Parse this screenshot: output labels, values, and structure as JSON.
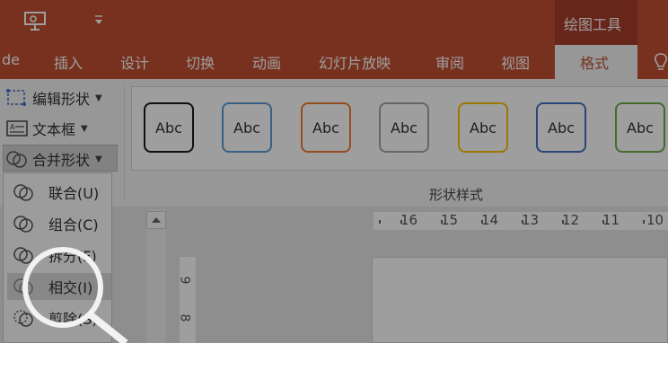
{
  "title_bar": {
    "drawing_tools_label": "绘图工具"
  },
  "tabs": [
    {
      "label": "de"
    },
    {
      "label": "插入"
    },
    {
      "label": "设计"
    },
    {
      "label": "切换"
    },
    {
      "label": "动画"
    },
    {
      "label": "幻灯片放映"
    },
    {
      "label": "审阅"
    },
    {
      "label": "视图"
    },
    {
      "label": "格式",
      "active": true
    }
  ],
  "ribbon": {
    "edit_shape": "编辑形状",
    "text_box": "文本框",
    "merge_shapes": "合并形状",
    "shape_styles_group": "形状样式",
    "style_swatches": [
      {
        "label": "Abc",
        "color": "#1a1a1a"
      },
      {
        "label": "Abc",
        "color": "#5b9bd5"
      },
      {
        "label": "Abc",
        "color": "#ed7d31"
      },
      {
        "label": "Abc",
        "color": "#a5a5a5"
      },
      {
        "label": "Abc",
        "color": "#ffc000"
      },
      {
        "label": "Abc",
        "color": "#4472c4"
      },
      {
        "label": "Abc",
        "color": "#70ad47"
      }
    ]
  },
  "merge_menu": {
    "items": [
      {
        "label": "联合(U)"
      },
      {
        "label": "组合(C)"
      },
      {
        "label": "拆分(F)"
      },
      {
        "label": "相交(I)",
        "highlighted": true
      },
      {
        "label": "剪除(S)"
      }
    ]
  },
  "ruler": {
    "horizontal_labels": [
      "16",
      "15",
      "14",
      "13",
      "12",
      "11",
      "10"
    ],
    "vertical_labels": [
      "9",
      "8"
    ]
  },
  "colors": {
    "accent": "#c24f33",
    "ribbon": "#f4f4f4"
  }
}
